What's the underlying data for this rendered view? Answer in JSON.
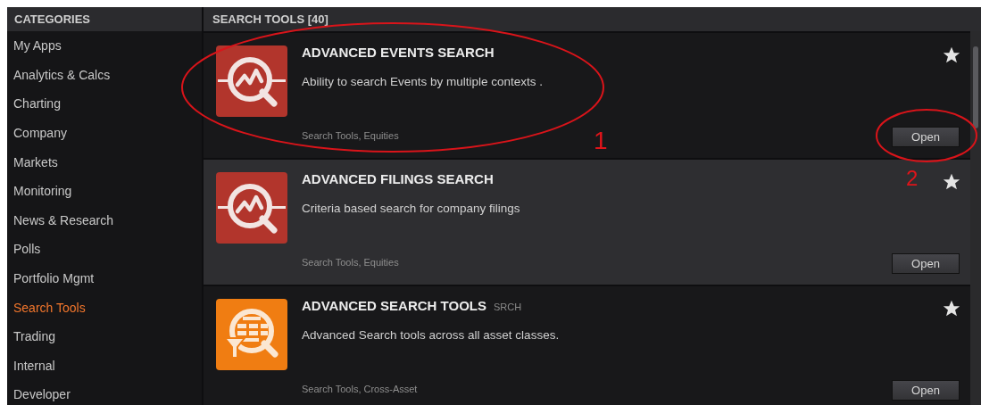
{
  "sidebar": {
    "title": "CATEGORIES",
    "items": [
      {
        "label": "My Apps",
        "selected": false
      },
      {
        "label": "Analytics & Calcs",
        "selected": false
      },
      {
        "label": "Charting",
        "selected": false
      },
      {
        "label": "Company",
        "selected": false
      },
      {
        "label": "Markets",
        "selected": false
      },
      {
        "label": "Monitoring",
        "selected": false
      },
      {
        "label": "News & Research",
        "selected": false
      },
      {
        "label": "Polls",
        "selected": false
      },
      {
        "label": "Portfolio Mgmt",
        "selected": false
      },
      {
        "label": "Search Tools",
        "selected": true
      },
      {
        "label": "Trading",
        "selected": false
      },
      {
        "label": "Internal",
        "selected": false
      },
      {
        "label": "Developer",
        "selected": false
      }
    ]
  },
  "main": {
    "title": "SEARCH TOOLS [40]",
    "apps": [
      {
        "kind": "events",
        "title": "ADVANCED EVENTS SEARCH",
        "description": "Ability to search Events by multiple contexts .",
        "tags": "Search Tools, Equities",
        "button": "Open",
        "highlighted": false
      },
      {
        "kind": "events",
        "title": "ADVANCED FILINGS SEARCH",
        "description": "Criteria based search for company filings",
        "tags": "Search Tools, Equities",
        "button": "Open",
        "highlighted": true
      },
      {
        "kind": "globe",
        "title": "ADVANCED SEARCH TOOLS",
        "code": "SRCH",
        "description": "Advanced Search tools across all asset classes.",
        "tags": "Search Tools, Cross-Asset",
        "button": "Open",
        "highlighted": false
      }
    ]
  },
  "annotations": [
    {
      "label": "1",
      "kind": "app"
    },
    {
      "label": "2",
      "kind": "button"
    }
  ]
}
